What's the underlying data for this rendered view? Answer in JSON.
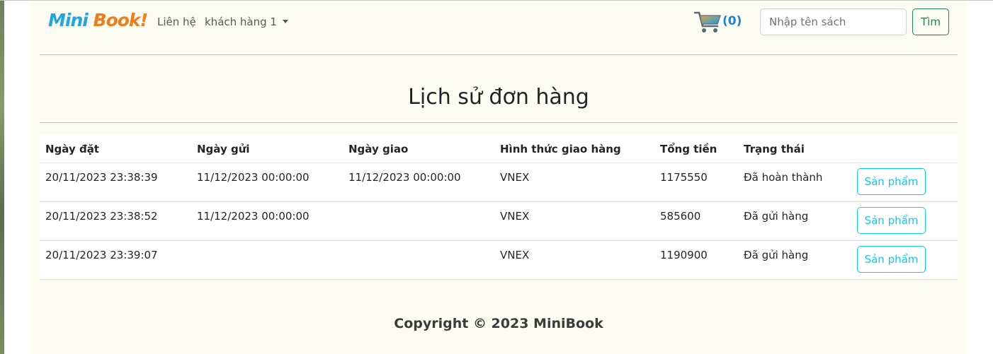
{
  "brand": {
    "part1": "Mini ",
    "part2": "Book!"
  },
  "nav": {
    "contact": "Liên hệ",
    "user": "khách hàng 1"
  },
  "cart": {
    "count": "(0)"
  },
  "search": {
    "placeholder": "Nhập tên sách",
    "button": "Tìm"
  },
  "page": {
    "title": "Lịch sử đơn hàng"
  },
  "table": {
    "headers": [
      "Ngày đặt",
      "Ngày gửi",
      "Ngày giao",
      "Hình thức giao hàng",
      "Tổng tiền",
      "Trạng thái"
    ],
    "rows": [
      [
        "20/11/2023 23:38:39",
        "11/12/2023 00:00:00",
        "11/12/2023 00:00:00",
        "VNEX",
        "1175550",
        "Đã hoàn thành"
      ],
      [
        "20/11/2023 23:38:52",
        "11/12/2023 00:00:00",
        "",
        "VNEX",
        "585600",
        "Đã gửi hàng"
      ],
      [
        "20/11/2023 23:39:07",
        "",
        "",
        "VNEX",
        "1190900",
        "Đã gửi hàng"
      ]
    ],
    "action_label": "Sản phẩm"
  },
  "footer": {
    "text": "Copyright © 2023 MiniBook"
  },
  "colors": {
    "brand_blue": "#1fa5e6",
    "brand_orange": "#f07d1a",
    "search_green": "#198754",
    "action_cyan": "#0dcaf0",
    "cart_blue": "#1e7fd6",
    "background": "#fcfcf2"
  }
}
